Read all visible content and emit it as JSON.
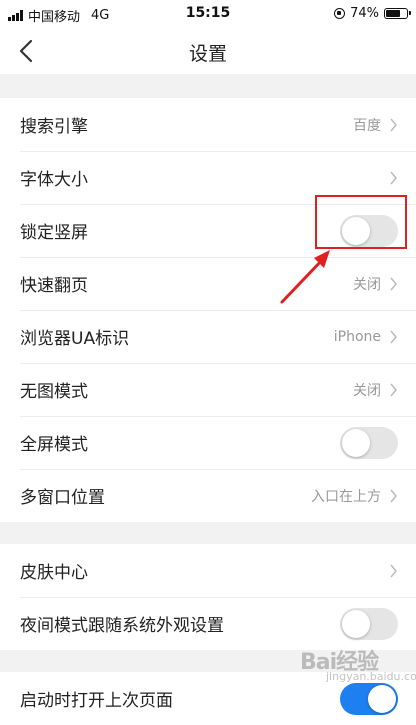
{
  "status_bar": {
    "carrier": "中国移动",
    "network": "4G",
    "time": "15:15",
    "battery_text": "74%",
    "battery_level": 0.74
  },
  "nav": {
    "title": "设置",
    "back_icon": "chevron-left-icon"
  },
  "group1": {
    "items": [
      {
        "label": "搜索引擎",
        "value": "百度"
      },
      {
        "label": "字体大小",
        "value": ""
      },
      {
        "label": "锁定竖屏",
        "toggle": false
      },
      {
        "label": "快速翻页",
        "value": "关闭"
      },
      {
        "label": "浏览器UA标识",
        "value": "iPhone"
      },
      {
        "label": "无图模式",
        "value": "关闭"
      },
      {
        "label": "全屏模式",
        "toggle": false
      },
      {
        "label": "多窗口位置",
        "value": "入口在上方"
      }
    ]
  },
  "group2": {
    "items": [
      {
        "label": "皮肤中心",
        "value": ""
      },
      {
        "label": "夜间模式跟随系统外观设置",
        "toggle": false
      }
    ]
  },
  "group3": {
    "items": [
      {
        "label": "启动时打开上次页面",
        "toggle": true
      }
    ]
  },
  "watermark": {
    "text": "Bai经验",
    "sub": "jingyan.baidu.com"
  },
  "colors": {
    "annotation_red": "#e02020",
    "toggle_on": "#1e7ff0",
    "toggle_off": "#e5e5e5"
  }
}
